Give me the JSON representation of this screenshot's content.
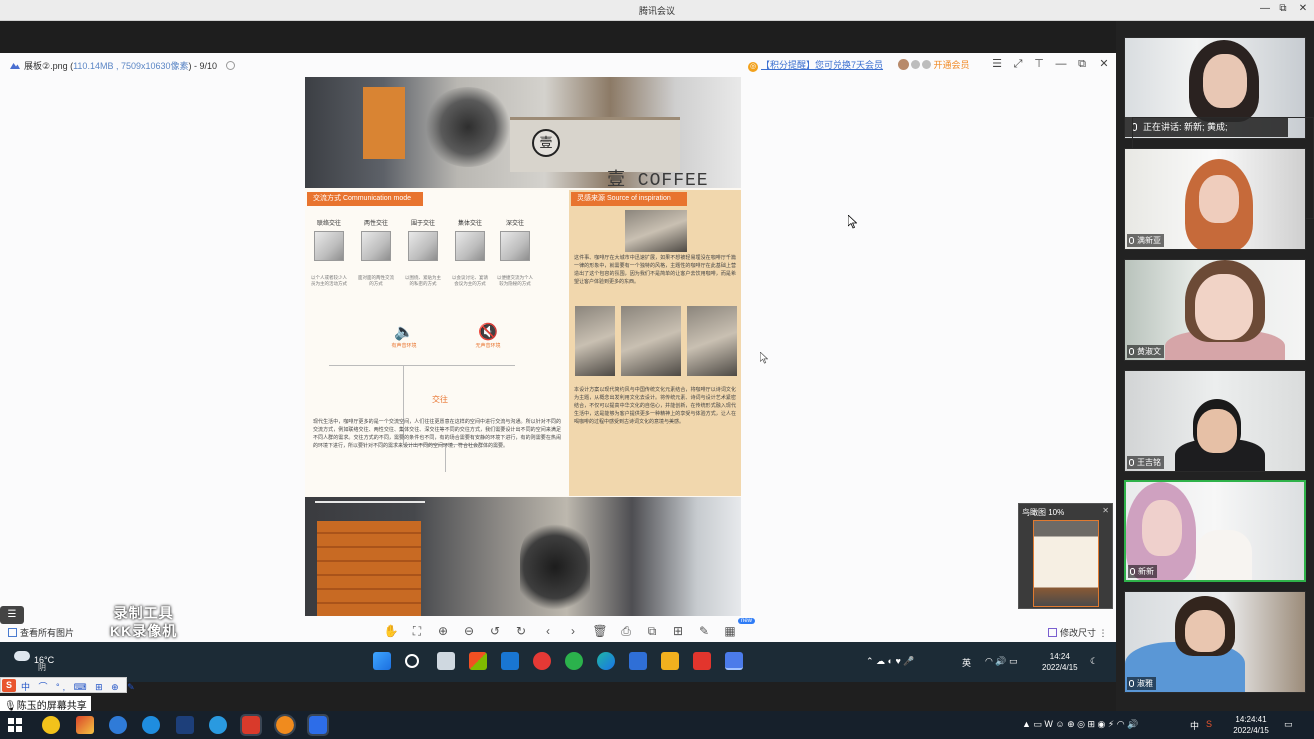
{
  "meeting": {
    "title": "腾讯会议",
    "controls": [
      "—",
      "⧉",
      "✕"
    ]
  },
  "viewer": {
    "filename": "展板②.png (",
    "fileinfo": "110.14MB , 7509x10630像素",
    "pageinfo": ") - 9/10",
    "promo": "【积分提醒】您可兑换7天会员",
    "vip_label": "开通会员",
    "see_all_label": "查看所有图片",
    "resize_label": "修改尺寸",
    "new_badge": "new",
    "thumbnail_title": "鸟瞰图 10%"
  },
  "poster": {
    "coffee_text": "壹 COFFEE",
    "logo_char": "壹",
    "left_tag": "交流方式 Communication mode",
    "right_tag": "灵感来源 Source of inspiration",
    "modes": [
      {
        "label": "联络交往",
        "desc": "以个人或者较少人员为主的活动方式"
      },
      {
        "label": "两性交往",
        "desc": "面对面的两性交流的方式"
      },
      {
        "label": "围于交往",
        "desc": "以围绕、紧贴为主的私密的方式"
      },
      {
        "label": "集体交往",
        "desc": "以会议讨论、宴请会议为主的方式"
      },
      {
        "label": "深交往",
        "desc": "以便捷交流为个人较为隐秘的方式"
      }
    ],
    "speaker_left": "有声音环境",
    "speaker_right": "无声音环境",
    "jiaowang": "交往",
    "left_body": "现代生活中，咖啡厅更多的是一个交流空间，人们往往更愿意在这样的空间中进行交流与沟通。所以针对不同的交流方式，例如联络交往、两性交往、集体交往、深交往等不同的交往方式，我们需要设计出不同的空间来满足不同人群的需求。交往方式的不同，需要的条件也不同，有的场合需要有安静的环境下进行，有的则需要在热闹的环境下进行，所以要针对不同的需求来设计出不同的空间环境，符合社会群体的需要。",
    "right_body_1": "这件事、咖啡厅在大城市中迅速扩展，如果不想被轻易埋没在咖啡厅千篇一律的形象中，就需要有一个独特的风格，主题性的咖啡厅在此基础上营造出了这个包容的氛围，因为我们不是简单的让客户去饮用咖啡，而是希望让客户体验到更多的东西。",
    "right_body_2": "本设计方案以现代简约风与中国传统文化元素结合，将咖啡厅以诗词文化为主题，从概念出发利用文化去设计。将传统元素、诗词与设计艺术紧密结合，不仅可以提高中华文化的自信心，并能创新，在传统形式融入现代生活中，这是能够为客户提供更多一种精神上的享受与体验方式，让人在喝咖啡的过程中感受到古诗词文化的意境与美感。"
  },
  "shared_taskbar": {
    "temperature": "16°C",
    "weather": "阴",
    "tray_text": "中",
    "ime_text": "英",
    "time": "14:24",
    "date": "2022/4/15"
  },
  "ime": {
    "logo": "S",
    "items": "中 ⌒ °, ⌨ ⊞ ⊕ ✎"
  },
  "share_label": "陈玉的屏幕共享",
  "watermark": {
    "line1": "录制工具",
    "line2": "KK录像机"
  },
  "video_panel": {
    "speaking": "正在讲话: 新新; 黄成;",
    "participants": [
      "满新亚",
      "黄淑文",
      "王吉铭",
      "新新",
      "淑雅"
    ]
  },
  "host_taskbar": {
    "tray": "中",
    "time": "14:24:41",
    "date": "2022/4/15"
  },
  "colors": {
    "accent": "#e8742f",
    "active_speaker": "#2fb24a",
    "link": "#3a6fd0"
  }
}
